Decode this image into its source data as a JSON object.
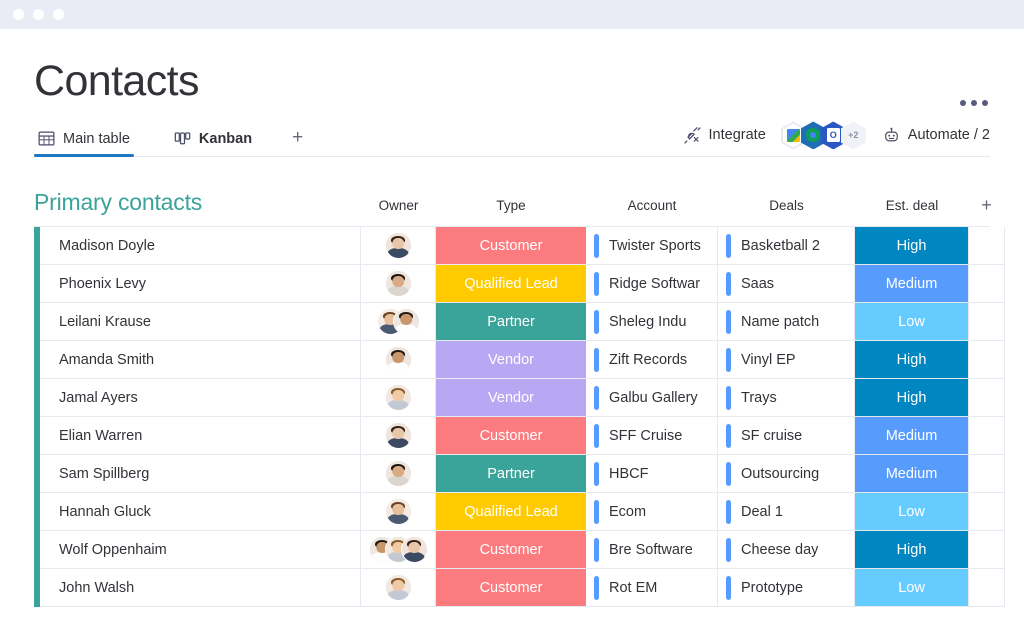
{
  "window": {
    "dots": [
      "dot-1",
      "dot-2",
      "dot-3"
    ]
  },
  "header": {
    "title": "Contacts",
    "more_menu": "•••"
  },
  "tabs": [
    {
      "label": "Main table",
      "icon": "table-icon",
      "active": true
    },
    {
      "label": "Kanban",
      "icon": "kanban-icon",
      "active": false
    }
  ],
  "tab_add_label": "+",
  "toolbar": {
    "integrate_label": "Integrate",
    "integrate_icon": "plug-icon",
    "automate_label": "Automate / 2",
    "automate_icon": "robot-icon",
    "integration_badges": [
      {
        "name": "google-sheets-badge",
        "style": "white"
      },
      {
        "name": "chrome-badge",
        "style": "teal"
      },
      {
        "name": "outlook-badge",
        "style": "blue",
        "letter": "O"
      },
      {
        "name": "more-integrations-badge",
        "style": "more",
        "label": "+2"
      }
    ]
  },
  "board": {
    "title": "Primary contacts",
    "accent_color": "#3aa39a",
    "add_column_label": "+",
    "columns": [
      {
        "key": "name",
        "label": ""
      },
      {
        "key": "owner",
        "label": "Owner"
      },
      {
        "key": "type",
        "label": "Type"
      },
      {
        "key": "account",
        "label": "Account"
      },
      {
        "key": "deals",
        "label": "Deals"
      },
      {
        "key": "est",
        "label": "Est. deal"
      }
    ],
    "type_colors": {
      "Customer": "#fb7b7f",
      "Qualified Lead": "#ffcb00",
      "Partner": "#3aa39a",
      "Vendor": "#b8a8f3"
    },
    "est_colors": {
      "High": "#0086c0",
      "Medium": "#579bfc",
      "Low": "#66ccff"
    },
    "link_pill_color": "#579bfc",
    "rows": [
      {
        "name": "Madison Doyle",
        "owners": 1,
        "type": "Customer",
        "account": "Twister Sports",
        "deal": "Basketball 2",
        "est": "High"
      },
      {
        "name": "Phoenix Levy",
        "owners": 1,
        "type": "Qualified Lead",
        "account": "Ridge Softwar",
        "deal": "Saas",
        "est": "Medium"
      },
      {
        "name": "Leilani Krause",
        "owners": 2,
        "type": "Partner",
        "account": "Sheleg Indu",
        "deal": "Name patch",
        "est": "Low"
      },
      {
        "name": "Amanda Smith",
        "owners": 1,
        "type": "Vendor",
        "account": "Zift Records",
        "deal": "Vinyl EP",
        "est": "High"
      },
      {
        "name": "Jamal Ayers",
        "owners": 1,
        "type": "Vendor",
        "account": "Galbu Gallery",
        "deal": "Trays",
        "est": "High"
      },
      {
        "name": "Elian Warren",
        "owners": 1,
        "type": "Customer",
        "account": "SFF Cruise",
        "deal": "SF cruise",
        "est": "Medium"
      },
      {
        "name": "Sam Spillberg",
        "owners": 1,
        "type": "Partner",
        "account": "HBCF",
        "deal": "Outsourcing",
        "est": "Medium"
      },
      {
        "name": "Hannah Gluck",
        "owners": 1,
        "type": "Qualified Lead",
        "account": "Ecom",
        "deal": "Deal 1",
        "est": "Low"
      },
      {
        "name": "Wolf Oppenhaim",
        "owners": 3,
        "type": "Customer",
        "account": "Bre Software",
        "deal": "Cheese day",
        "est": "High"
      },
      {
        "name": "John Walsh",
        "owners": 1,
        "type": "Customer",
        "account": "Rot EM",
        "deal": "Prototype",
        "est": "Low"
      }
    ]
  }
}
